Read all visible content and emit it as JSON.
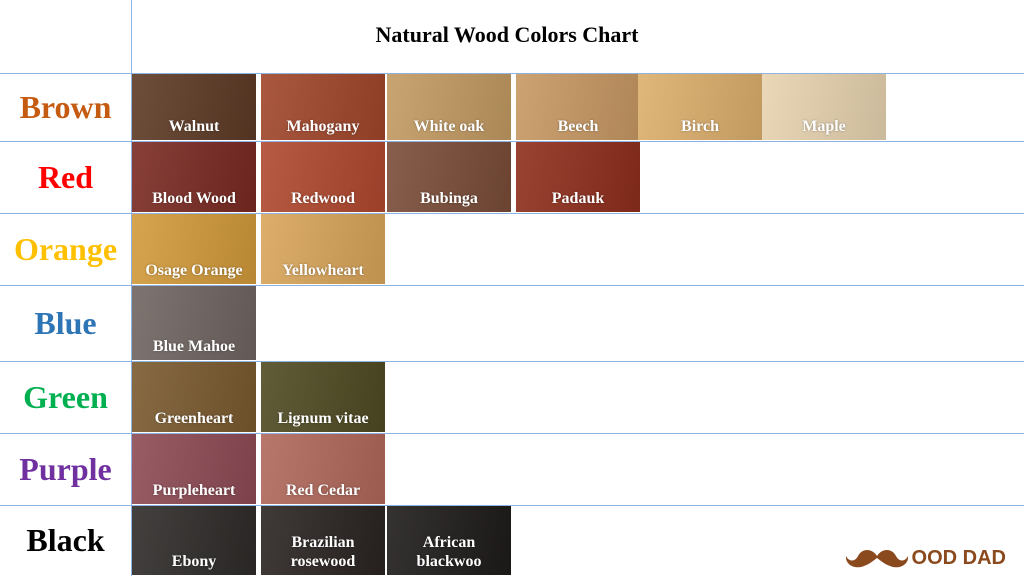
{
  "title": "Natural Wood Colors Chart",
  "rows": [
    {
      "label": "Brown",
      "color": "#c55a11",
      "woods": [
        {
          "name": "Walnut",
          "color": "#5d3a25"
        },
        {
          "name": "Mahogany",
          "color": "#a0462a"
        },
        {
          "name": "White oak",
          "color": "#c29a62"
        },
        {
          "name": "Beech",
          "color": "#c79863"
        },
        {
          "name": "Birch",
          "color": "#dcaf6c"
        },
        {
          "name": "Maple",
          "color": "#e7d3b0"
        }
      ]
    },
    {
      "label": "Red",
      "color": "#ff0000",
      "woods": [
        {
          "name": "Blood Wood",
          "color": "#7a2a22"
        },
        {
          "name": "Redwood",
          "color": "#b0482f"
        },
        {
          "name": "Bubinga",
          "color": "#7a4c38"
        },
        {
          "name": "Padauk",
          "color": "#8e2e1c"
        }
      ]
    },
    {
      "label": "Orange",
      "color": "#ffc000",
      "woods": [
        {
          "name": "Osage Orange",
          "color": "#d29a3a"
        },
        {
          "name": "Yellowheart",
          "color": "#d9a55a"
        }
      ]
    },
    {
      "label": "Blue",
      "color": "#2e75b6",
      "woods": [
        {
          "name": "Blue Mahoe",
          "color": "#6f6561"
        }
      ]
    },
    {
      "label": "Green",
      "color": "#00b050",
      "woods": [
        {
          "name": "Greenheart",
          "color": "#7a5a2e"
        },
        {
          "name": "Lignum vitae",
          "color": "#4f4a22"
        }
      ]
    },
    {
      "label": "Purple",
      "color": "#7030a0",
      "woods": [
        {
          "name": "Purpleheart",
          "color": "#8d4a54"
        },
        {
          "name": "Red Cedar",
          "color": "#b0685a"
        }
      ]
    },
    {
      "label": "Black",
      "color": "#000000",
      "woods": [
        {
          "name": "Ebony",
          "color": "#2e2b29"
        },
        {
          "name": "Brazilian\nrosewood",
          "color": "#2a2422"
        },
        {
          "name": "African\nblackwoo",
          "color": "#1e1b1a"
        }
      ]
    }
  ],
  "logo": {
    "text": "OOD DAD",
    "icon": "mustache-icon"
  }
}
